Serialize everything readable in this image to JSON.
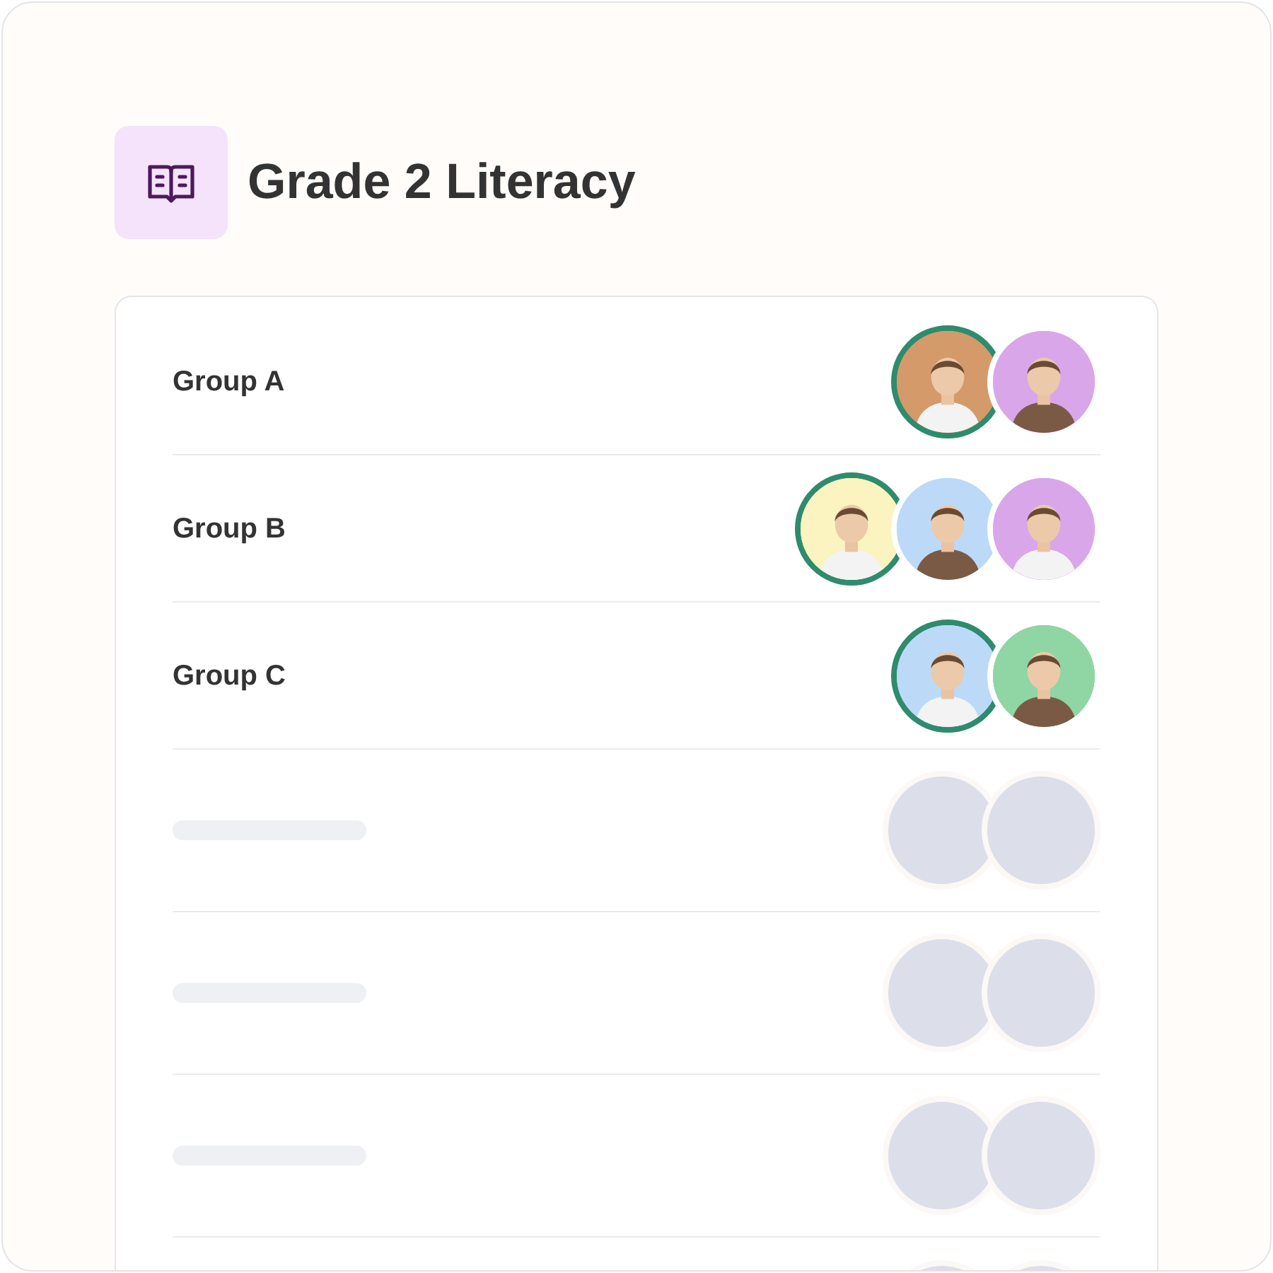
{
  "header": {
    "title": "Grade 2 Literacy"
  },
  "rows": [
    {
      "kind": "group",
      "name": "Group A",
      "avatars": [
        {
          "kind": "teacher",
          "color": "#d49a6a"
        },
        {
          "kind": "student",
          "color": "#d9a6ea"
        }
      ]
    },
    {
      "kind": "group",
      "name": "Group B",
      "avatars": [
        {
          "kind": "teacher",
          "color": "#fbf3c0"
        },
        {
          "kind": "student",
          "color": "#bcd9f8"
        },
        {
          "kind": "student",
          "color": "#d9a6ea"
        }
      ]
    },
    {
      "kind": "group",
      "name": "Group C",
      "avatars": [
        {
          "kind": "teacher",
          "color": "#bcd9f8"
        },
        {
          "kind": "student",
          "color": "#8fd6a4"
        }
      ]
    },
    {
      "kind": "loading",
      "avatars": [
        {
          "kind": "placeholder"
        },
        {
          "kind": "placeholder"
        }
      ]
    },
    {
      "kind": "loading",
      "avatars": [
        {
          "kind": "placeholder"
        },
        {
          "kind": "placeholder"
        }
      ]
    },
    {
      "kind": "loading",
      "avatars": [
        {
          "kind": "placeholder"
        },
        {
          "kind": "placeholder"
        }
      ]
    },
    {
      "kind": "cut_off",
      "avatars": [
        {
          "kind": "placeholder"
        },
        {
          "kind": "placeholder"
        }
      ]
    }
  ]
}
